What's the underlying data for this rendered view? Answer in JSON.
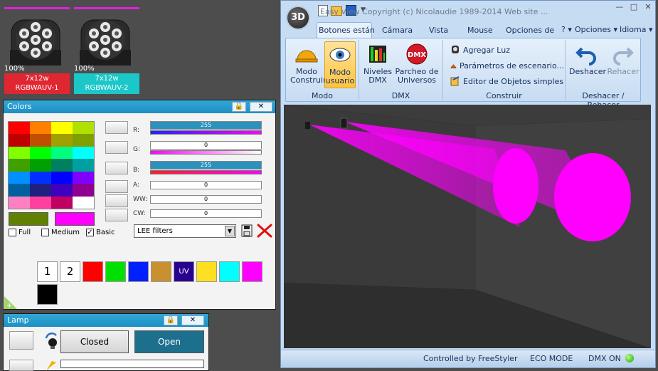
{
  "fixtures": [
    {
      "percent": "100%",
      "name": "7x12w",
      "sub": "RGBWAUV-1",
      "label_bg": "#e02731"
    },
    {
      "percent": "100%",
      "name": "7x12w",
      "sub": "RGBWAUV-2",
      "label_bg": "#1cc7c9"
    }
  ],
  "colors_panel": {
    "title": "Colors",
    "swatches": [
      "#ff0000",
      "#ff8000",
      "#ffff00",
      "#b0e000",
      "#c00000",
      "#c05000",
      "#a0a000",
      "#80a000",
      "#80ff00",
      "#00ff00",
      "#00ff80",
      "#00ffff",
      "#40a000",
      "#00a000",
      "#008060",
      "#00a0a0",
      "#0090ff",
      "#0030ff",
      "#0000ff",
      "#8000ff",
      "#0060a0",
      "#202080",
      "#4000c0",
      "#900090",
      "#ff80c0",
      "#ff40a0",
      "#c00060",
      "#ffffff"
    ],
    "chip_left": "#608000",
    "chip_right": "#ff00ff",
    "mode_full": "Full",
    "mode_medium": "Medium",
    "mode_basic": "Basic",
    "channels": [
      {
        "label": "R:",
        "value": "255"
      },
      {
        "label": "G:",
        "value": "0"
      },
      {
        "label": "B:",
        "value": "255"
      },
      {
        "label": "A:",
        "value": "0"
      },
      {
        "label": "WW:",
        "value": "0"
      },
      {
        "label": "CW:",
        "value": "0"
      }
    ],
    "filter_select": "LEE filters",
    "presets": [
      {
        "label": "1",
        "color": "#ffffff",
        "fg": "#000000"
      },
      {
        "label": "2",
        "color": "#ffffff",
        "fg": "#000000"
      },
      {
        "label": "",
        "color": "#ff0000",
        "fg": "#ffffff"
      },
      {
        "label": "",
        "color": "#00e000",
        "fg": "#ffffff"
      },
      {
        "label": "",
        "color": "#0020ff",
        "fg": "#ffffff"
      },
      {
        "label": "",
        "color": "#c89030",
        "fg": "#ffffff"
      },
      {
        "label": "UV",
        "color": "#2a0090",
        "fg": "#ffffff"
      },
      {
        "label": "",
        "color": "#ffe020",
        "fg": "#ffffff"
      },
      {
        "label": "",
        "color": "#00ffff",
        "fg": "#ffffff"
      },
      {
        "label": "",
        "color": "#ff00ff",
        "fg": "#ffffff"
      },
      {
        "label": "",
        "color": "#000000",
        "fg": "#ffffff"
      }
    ]
  },
  "lamp_panel": {
    "title": "Lamp",
    "closed": "Closed",
    "open": "Open"
  },
  "easyview": {
    "title": "Easy View   Copyright (c) Nicolaudie 1989-2014   Web site ...",
    "tabs": [
      "Botones están",
      "Cámara",
      "Vista",
      "Mouse",
      "Opciones de i"
    ],
    "right_menu": [
      "? ▾",
      "Opciones ▾",
      "Idioma ▾"
    ],
    "groups": {
      "modo": "Modo",
      "dmx": "DMX",
      "construir": "Construir",
      "deshacer": "Deshacer / Rehacer"
    },
    "buttons": {
      "modo_construir": [
        "Modo",
        "Construir"
      ],
      "modo_usuario": [
        "Modo",
        "usuario"
      ],
      "niveles": [
        "Niveles",
        "DMX"
      ],
      "parcheo": [
        "Parcheo de",
        "Universos"
      ],
      "deshacer": "Deshacer",
      "rehacer": "Rehacer"
    },
    "construir_items": [
      "Agregar Luz",
      "Parámetros de escenario...",
      "Editor de Objetos simples"
    ],
    "status": {
      "freestyler": "Controlled by FreeStyler",
      "eco": "ECO MODE",
      "dmx": "DMX ON"
    }
  }
}
